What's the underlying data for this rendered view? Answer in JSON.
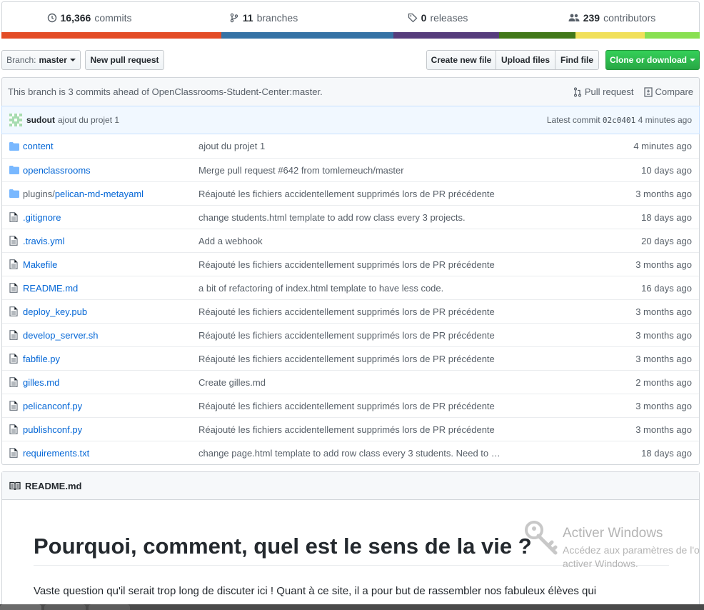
{
  "summary": {
    "commits_count": "16,366",
    "commits_label": "commits",
    "branches_count": "11",
    "branches_label": "branches",
    "releases_count": "0",
    "releases_label": "releases",
    "contributors_count": "239",
    "contributors_label": "contributors",
    "language_bar": [
      {
        "color": "#e34c26",
        "fraction": 0.315
      },
      {
        "color": "#3572A5",
        "fraction": 0.246
      },
      {
        "color": "#563d7c",
        "fraction": 0.152
      },
      {
        "color": "#427819",
        "fraction": 0.109
      },
      {
        "color": "#f1e05a",
        "fraction": 0.099
      },
      {
        "color": "#89e051",
        "fraction": 0.079
      }
    ]
  },
  "toolbar": {
    "branch_prefix": "Branch:",
    "branch_name": "master",
    "new_pull_request": "New pull request",
    "create_new_file": "Create new file",
    "upload_files": "Upload files",
    "find_file": "Find file",
    "clone_or_download": "Clone or download"
  },
  "branch_info": {
    "message": "This branch is 3 commits ahead of OpenClassrooms-Student-Center:master.",
    "pull_request": "Pull request",
    "compare": "Compare"
  },
  "commit_tease": {
    "author": "sudout",
    "message": "ajout du projet 1",
    "latest_label": "Latest commit",
    "sha": "02c0401",
    "age": "4 minutes ago"
  },
  "files": [
    {
      "type": "dir",
      "name": "content",
      "prefix": "",
      "message": "ajout du projet 1",
      "age": "4 minutes ago"
    },
    {
      "type": "dir",
      "name": "openclassrooms",
      "prefix": "",
      "message": "Merge pull request #642 from tomlemeuch/master",
      "age": "10 days ago"
    },
    {
      "type": "dir",
      "name": "pelican-md-metayaml",
      "prefix": "plugins/",
      "message": "Réajouté les fichiers accidentellement supprimés lors de PR précédente",
      "age": "3 months ago"
    },
    {
      "type": "file",
      "name": ".gitignore",
      "prefix": "",
      "message": "change students.html template to add row class every 3 projects.",
      "age": "18 days ago"
    },
    {
      "type": "file",
      "name": ".travis.yml",
      "prefix": "",
      "message": "Add a webhook",
      "age": "20 days ago"
    },
    {
      "type": "file",
      "name": "Makefile",
      "prefix": "",
      "message": "Réajouté les fichiers accidentellement supprimés lors de PR précédente",
      "age": "3 months ago"
    },
    {
      "type": "file",
      "name": "README.md",
      "prefix": "",
      "message": "a bit of refactoring of index.html template to have less code.",
      "age": "16 days ago"
    },
    {
      "type": "file",
      "name": "deploy_key.pub",
      "prefix": "",
      "message": "Réajouté les fichiers accidentellement supprimés lors de PR précédente",
      "age": "3 months ago"
    },
    {
      "type": "file",
      "name": "develop_server.sh",
      "prefix": "",
      "message": "Réajouté les fichiers accidentellement supprimés lors de PR précédente",
      "age": "3 months ago"
    },
    {
      "type": "file",
      "name": "fabfile.py",
      "prefix": "",
      "message": "Réajouté les fichiers accidentellement supprimés lors de PR précédente",
      "age": "3 months ago"
    },
    {
      "type": "file",
      "name": "gilles.md",
      "prefix": "",
      "message": "Create gilles.md",
      "age": "2 months ago"
    },
    {
      "type": "file",
      "name": "pelicanconf.py",
      "prefix": "",
      "message": "Réajouté les fichiers accidentellement supprimés lors de PR précédente",
      "age": "3 months ago"
    },
    {
      "type": "file",
      "name": "publishconf.py",
      "prefix": "",
      "message": "Réajouté les fichiers accidentellement supprimés lors de PR précédente",
      "age": "3 months ago"
    },
    {
      "type": "file",
      "name": "requirements.txt",
      "prefix": "",
      "message": "change page.html template to add row class every 3 students. Need to …",
      "age": "18 days ago"
    }
  ],
  "readme": {
    "filename": "README.md",
    "heading": "Pourquoi, comment, quel est le sens de la vie ?",
    "paragraph": "Vaste question qu'il serait trop long de discuter ici ! Quant à ce site, il a pour but de rassembler nos fabuleux élèves qui"
  },
  "watermark": {
    "title": "Activer Windows",
    "line1": "Accédez aux paramètres de l'o",
    "line2": "activer Windows."
  }
}
